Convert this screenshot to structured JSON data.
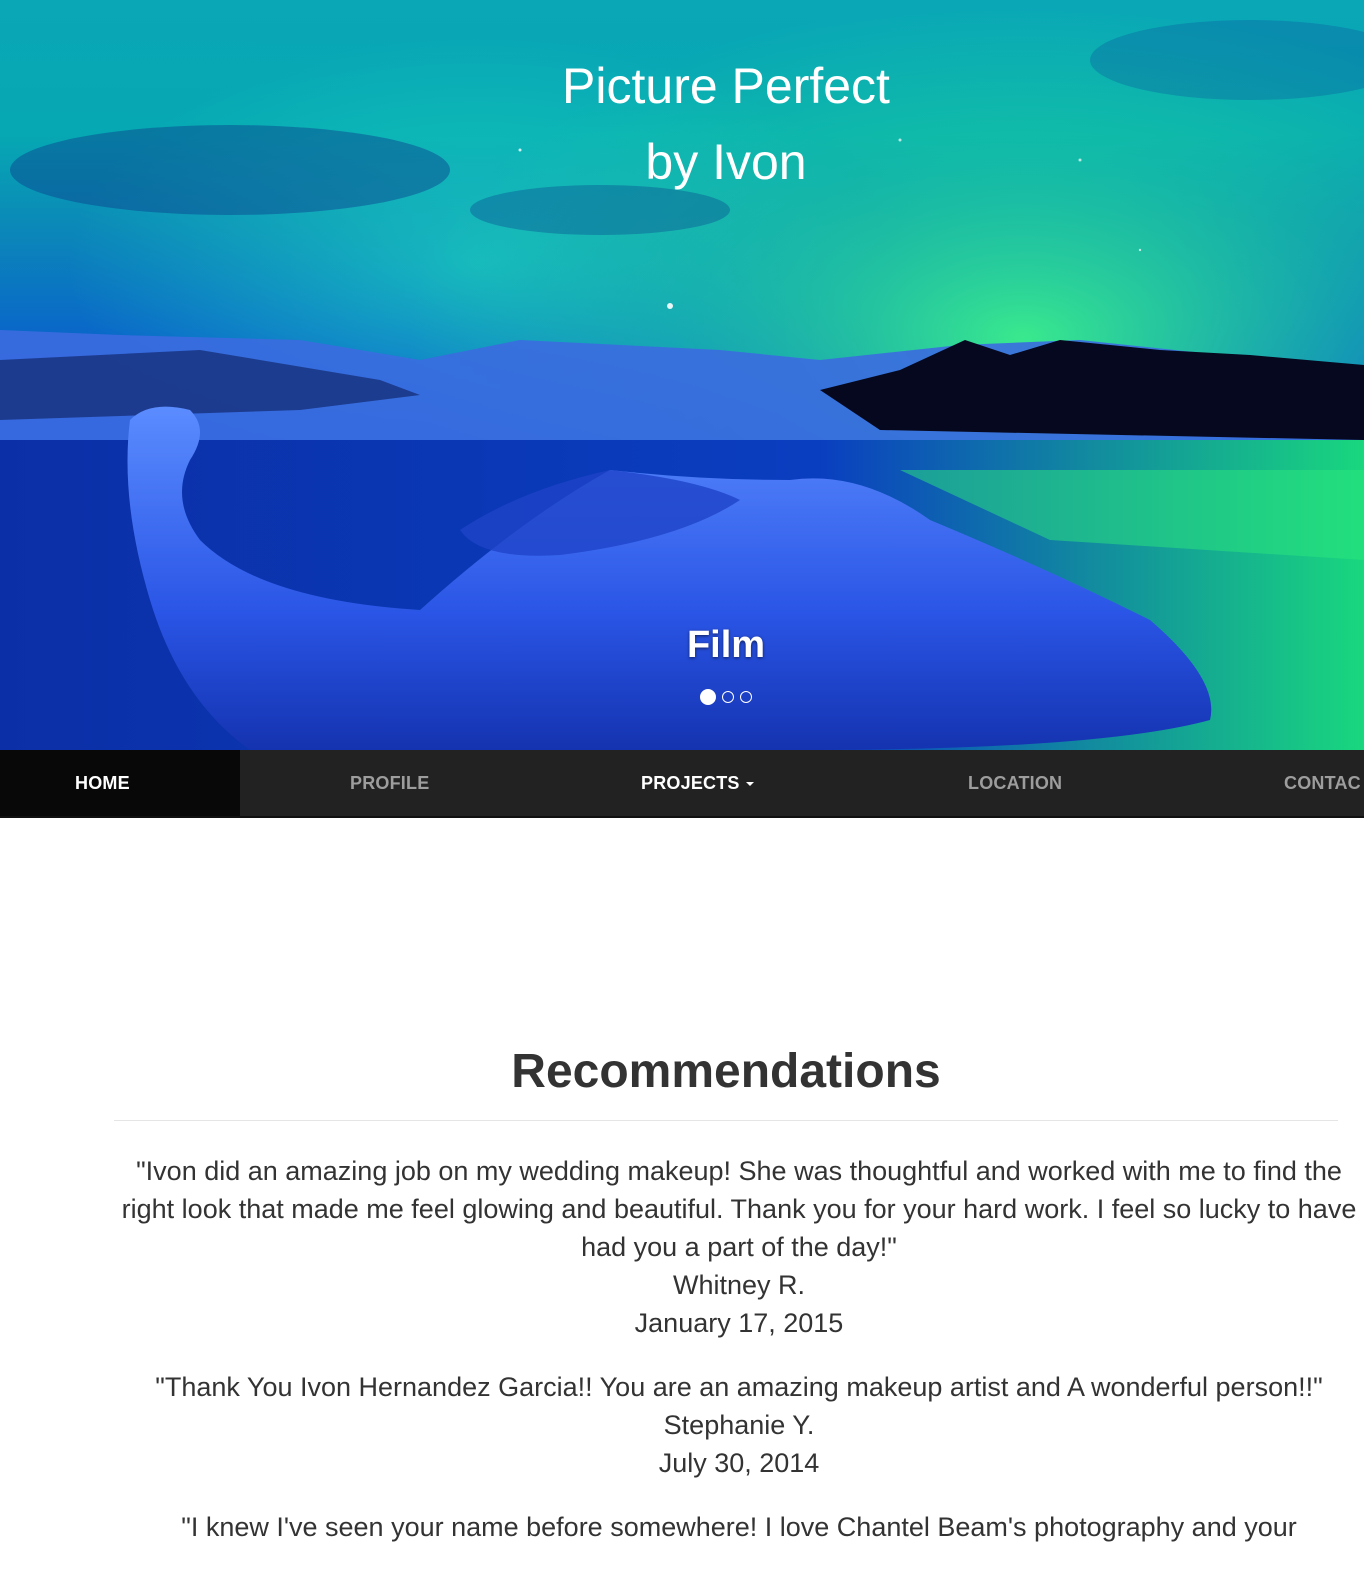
{
  "hero": {
    "title_line1": "Picture Perfect",
    "title_line2": "by Ivon",
    "caption": "Film",
    "slide_count": 3,
    "active_slide": 1
  },
  "nav": {
    "items": [
      {
        "label": "HOME",
        "active": true
      },
      {
        "label": "PROFILE",
        "active": false
      },
      {
        "label": "PROJECTS",
        "active": false,
        "dropdown": true
      },
      {
        "label": "LOCATION",
        "active": false
      },
      {
        "label": "CONTAC",
        "active": false
      }
    ]
  },
  "recommendations": {
    "heading": "Recommendations",
    "items": [
      {
        "quote": "\"Ivon did an amazing job on my wedding makeup! She was thoughtful and worked with me to find the right look that made me feel glowing and beautiful. Thank you for your hard work. I feel so lucky to have had you a part of the day!\"",
        "author": "Whitney R.",
        "date": "January 17, 2015"
      },
      {
        "quote": "\"Thank You Ivon Hernandez Garcia!! You are an amazing makeup artist and A wonderful person!!\"",
        "author": "Stephanie Y.",
        "date": "July 30, 2014"
      },
      {
        "quote": "\"I knew I've seen your name before somewhere! I love Chantel Beam's photography and your",
        "author": "",
        "date": ""
      }
    ]
  },
  "colors": {
    "nav_bg": "#222222",
    "nav_active_bg": "#080808",
    "nav_text": "#9d9d9d",
    "text": "#333333"
  }
}
